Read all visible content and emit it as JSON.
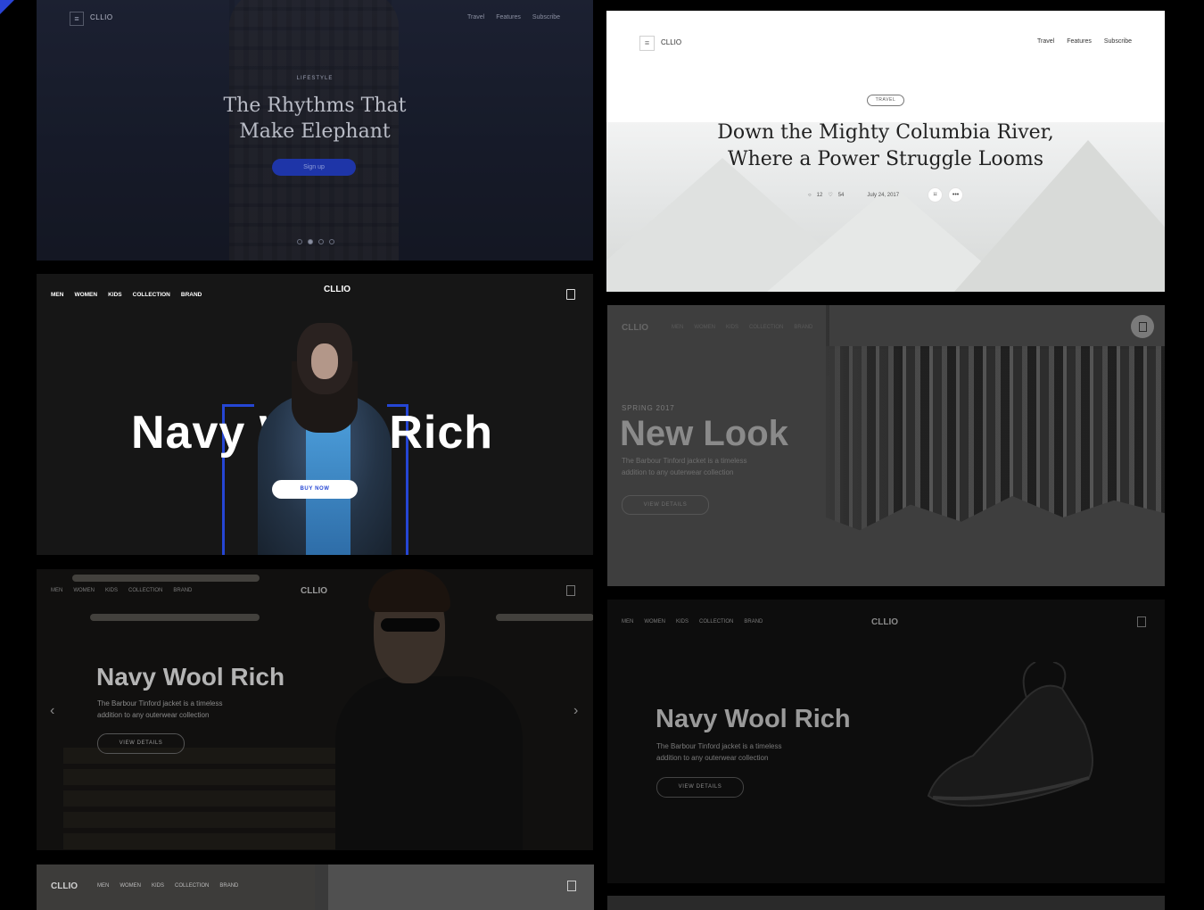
{
  "panel1": {
    "brand": "CLLIO",
    "nav": [
      "Travel",
      "Features",
      "Subscribe"
    ],
    "kicker": "LIFESTYLE",
    "title_line1": "The Rhythms That",
    "title_line2": "Make Elephant",
    "button": "Sign up",
    "slides": 4,
    "active_slide": 2
  },
  "panel2": {
    "brand": "CLLIO",
    "nav": [
      "Travel",
      "Features",
      "Subscribe"
    ],
    "tag": "TRAVEL",
    "title_line1": "Down the Mighty Columbia River,",
    "title_line2": "Where a Power Struggle Looms",
    "comments": "12",
    "likes": "54",
    "date": "July 24, 2017"
  },
  "panel3": {
    "brand": "CLLIO",
    "nav": [
      "MEN",
      "WOMEN",
      "KIDS",
      "COLLECTION",
      "BRAND"
    ],
    "title": "Navy Wool Rich",
    "button": "BUY NOW",
    "accent": "#2546d4"
  },
  "panel4": {
    "brand": "CLLIO",
    "nav": [
      "MEN",
      "WOMEN",
      "KIDS",
      "COLLECTION",
      "BRAND"
    ],
    "kicker": "SPRING 2017",
    "title": "New Look",
    "desc_line1": "The Barbour Tinford jacket is a timeless",
    "desc_line2": "addition to any outerwear collection",
    "button": "VIEW DETAILS"
  },
  "panel5": {
    "brand": "CLLIO",
    "nav": [
      "MEN",
      "WOMEN",
      "KIDS",
      "COLLECTION",
      "BRAND"
    ],
    "title": "Navy Wool Rich",
    "desc_line1": "The Barbour Tinford jacket is a timeless",
    "desc_line2": "addition to any outerwear collection",
    "button": "VIEW DETAILS",
    "prev": "‹",
    "next": "›"
  },
  "panel6": {
    "brand": "CLLIO",
    "nav": [
      "MEN",
      "WOMEN",
      "KIDS",
      "COLLECTION",
      "BRAND"
    ],
    "title": "Navy Wool Rich",
    "desc_line1": "The Barbour Tinford jacket is a timeless",
    "desc_line2": "addition to any outerwear collection",
    "button": "VIEW DETAILS"
  },
  "panel7": {
    "brand": "CLLIO",
    "nav": [
      "MEN",
      "WOMEN",
      "KIDS",
      "COLLECTION",
      "BRAND"
    ]
  },
  "icons": {
    "menu": "menu-icon",
    "bag": "shopping-bag-icon",
    "comment": "comment-icon",
    "heart": "heart-icon",
    "bookmark": "bookmark-icon",
    "more": "more-icon"
  }
}
